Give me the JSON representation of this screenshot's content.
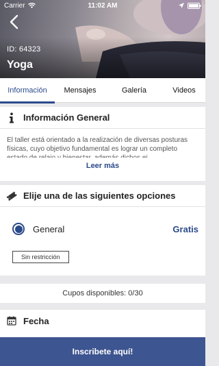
{
  "status_bar": {
    "carrier": "Carrier",
    "time": "11:02 AM"
  },
  "header": {
    "id_label": "ID: 64323",
    "title": "Yoga"
  },
  "tabs": [
    {
      "label": "Información",
      "active": true
    },
    {
      "label": "Mensajes",
      "active": false
    },
    {
      "label": "Galería",
      "active": false
    },
    {
      "label": "Videos",
      "active": false
    }
  ],
  "general_info": {
    "title": "Información General",
    "description": "El taller está orientado a la realización de diversas posturas físicas, cuyo objetivo fundamental es lograr un completo estado de relajo y bienestar, además dichos ej...",
    "read_more": "Leer más"
  },
  "options": {
    "title": "Elije una de las siguientes opciones",
    "items": [
      {
        "name": "General",
        "price": "Gratis",
        "restriction": "Sin restricción",
        "selected": true
      }
    ]
  },
  "availability": {
    "text": "Cupos disponibles: 0/30"
  },
  "date_section": {
    "title": "Fecha"
  },
  "cta": {
    "label": "Inscribete aquí!"
  },
  "colors": {
    "accent": "#2a4a8a",
    "cta_bg": "#3d5590",
    "background": "#e9e9ec"
  },
  "icons": [
    "back-chevron",
    "info-i",
    "ticket",
    "calendar",
    "wifi",
    "location-arrow",
    "battery"
  ]
}
